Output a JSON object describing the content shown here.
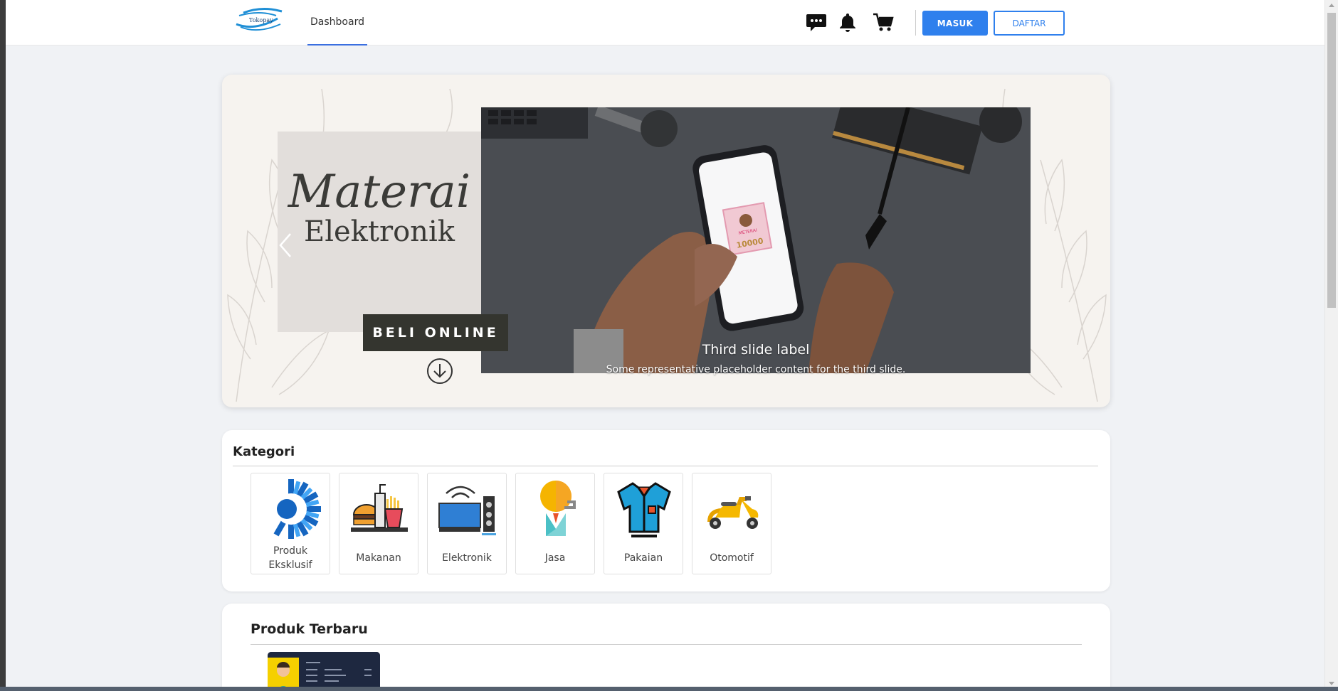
{
  "navbar": {
    "logo_text": "Tokopay",
    "tab_label": "Dashboard",
    "icons": [
      "chat-icon",
      "bell-icon",
      "cart-icon"
    ],
    "masuk_label": "MASUK",
    "daftar_label": "DAFTAR",
    "accent": "#2f80ed"
  },
  "hero": {
    "title_main": "Materai",
    "title_sub": "Elektronik",
    "cta_label": "BELI ONLINE",
    "caption_title": "Third slide label",
    "caption_text": "Some representative placeholder content for the third slide.",
    "stamp_text": "METERAI",
    "stamp_value": "10000"
  },
  "kategori": {
    "heading": "Kategori",
    "items": [
      {
        "label": "Produk Eksklusif",
        "icon": "exclusive-burst-icon"
      },
      {
        "label": "Makanan",
        "icon": "fast-food-icon"
      },
      {
        "label": "Elektronik",
        "icon": "tv-speaker-icon"
      },
      {
        "label": "Jasa",
        "icon": "service-person-icon"
      },
      {
        "label": "Pakaian",
        "icon": "shirt-icon"
      },
      {
        "label": "Otomotif",
        "icon": "scooter-icon"
      }
    ]
  },
  "produk": {
    "heading": "Produk Terbaru"
  }
}
